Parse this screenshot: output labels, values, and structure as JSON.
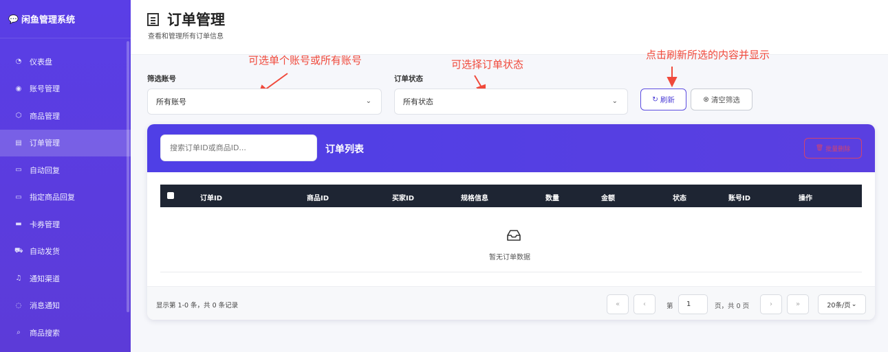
{
  "sidebar": {
    "brand_icon": "chat-bubble-icon",
    "brand": "闲鱼管理系统",
    "items": [
      {
        "icon": "dashboard-icon",
        "glyph": "◔",
        "label": "仪表盘",
        "active": false
      },
      {
        "icon": "user-icon",
        "glyph": "◉",
        "label": "账号管理",
        "active": false
      },
      {
        "icon": "box-icon",
        "glyph": "⬡",
        "label": "商品管理",
        "active": false
      },
      {
        "icon": "order-list-icon",
        "glyph": "▤",
        "label": "订单管理",
        "active": true
      },
      {
        "icon": "chat-reply-icon",
        "glyph": "▭",
        "label": "自动回复",
        "active": false
      },
      {
        "icon": "chat-reply-icon",
        "glyph": "▭",
        "label": "指定商品回复",
        "active": false
      },
      {
        "icon": "card-icon",
        "glyph": "▬",
        "label": "卡券管理",
        "active": false
      },
      {
        "icon": "truck-icon",
        "glyph": "⛟",
        "label": "自动发货",
        "active": false
      },
      {
        "icon": "bell-icon",
        "glyph": "♫",
        "label": "通知渠道",
        "active": false
      },
      {
        "icon": "message-icon",
        "glyph": "◌",
        "label": "消息通知",
        "active": false
      },
      {
        "icon": "search-icon",
        "glyph": "⌕",
        "label": "商品搜索",
        "active": false
      }
    ]
  },
  "header": {
    "title": "订单管理",
    "subtitle": "查看和管理所有订单信息"
  },
  "annotations": {
    "account": "可选单个账号或所有账号",
    "status": "可选择订单状态",
    "refresh": "点击刷新所选的内容并显示"
  },
  "filters": {
    "account_label": "筛选账号",
    "account_value": "所有账号",
    "status_label": "订单状态",
    "status_value": "所有状态",
    "refresh_button": "刷新",
    "clear_button": "清空筛选"
  },
  "card": {
    "search_placeholder": "搜索订单ID或商品ID...",
    "title": "订单列表",
    "bulk_delete": "批量删除",
    "columns": [
      "订单ID",
      "商品ID",
      "买家ID",
      "规格信息",
      "数量",
      "金额",
      "状态",
      "账号ID",
      "操作"
    ],
    "rows": [],
    "empty_text": "暂无订单数据"
  },
  "pagination": {
    "summary": "显示第 1-0 条，共 0 条记录",
    "page_prefix": "第",
    "page_value": "1",
    "page_suffix": "页，共 0 页",
    "page_size": "20条/页"
  },
  "colors": {
    "sidebar": "#5a3ee6",
    "annotation": "#f0493b",
    "table_header": "#1e2533",
    "danger": "#e8455a"
  }
}
